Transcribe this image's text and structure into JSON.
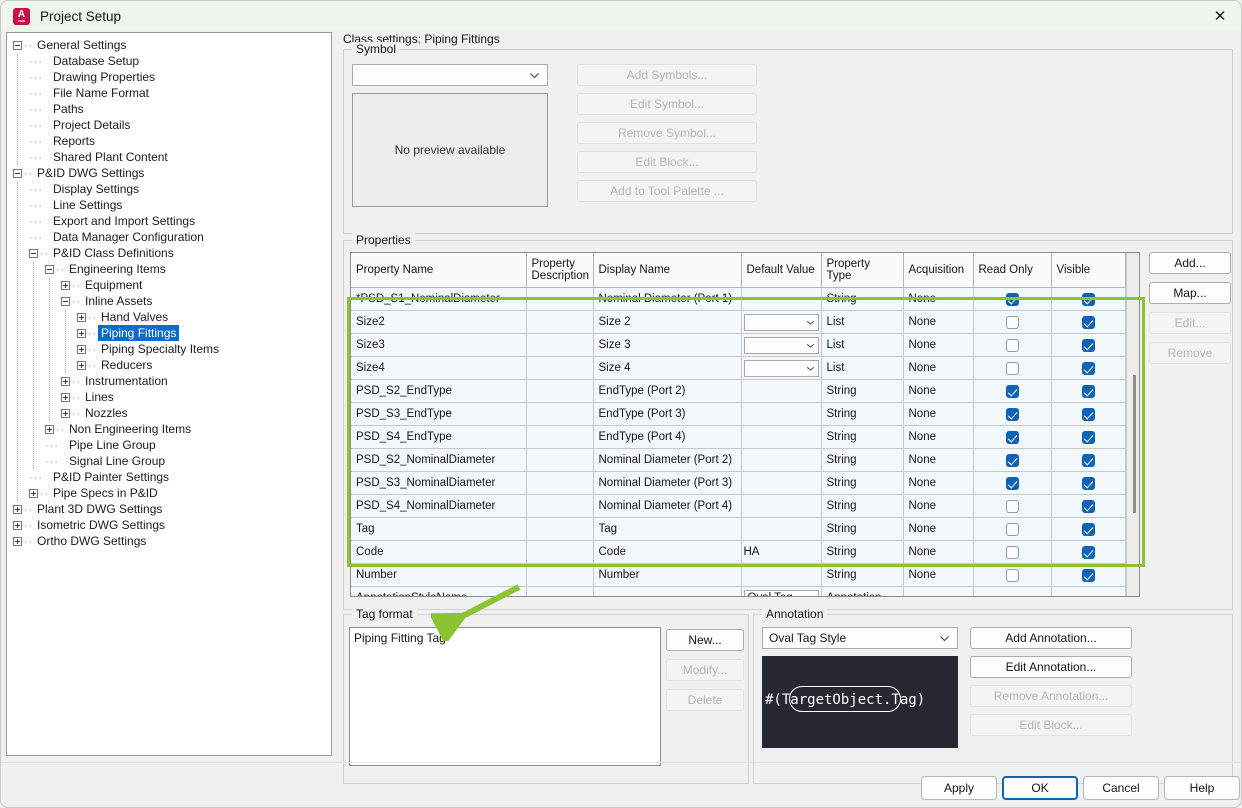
{
  "window": {
    "title": "Project Setup",
    "close_icon": "close-icon",
    "app_icon": "autocad-icon"
  },
  "tree": {
    "items": [
      {
        "label": "General Settings",
        "depth": 0,
        "toggle": "minus"
      },
      {
        "label": "Database Setup",
        "depth": 1,
        "toggle": "none"
      },
      {
        "label": "Drawing Properties",
        "depth": 1,
        "toggle": "none"
      },
      {
        "label": "File Name Format",
        "depth": 1,
        "toggle": "none"
      },
      {
        "label": "Paths",
        "depth": 1,
        "toggle": "none"
      },
      {
        "label": "Project Details",
        "depth": 1,
        "toggle": "none"
      },
      {
        "label": "Reports",
        "depth": 1,
        "toggle": "none"
      },
      {
        "label": "Shared Plant Content",
        "depth": 1,
        "toggle": "none"
      },
      {
        "label": "P&ID DWG Settings",
        "depth": 0,
        "toggle": "minus"
      },
      {
        "label": "Display Settings",
        "depth": 1,
        "toggle": "none"
      },
      {
        "label": "Line Settings",
        "depth": 1,
        "toggle": "none"
      },
      {
        "label": "Export and Import Settings",
        "depth": 1,
        "toggle": "none"
      },
      {
        "label": "Data Manager Configuration",
        "depth": 1,
        "toggle": "none"
      },
      {
        "label": "P&ID Class Definitions",
        "depth": 1,
        "toggle": "minus"
      },
      {
        "label": "Engineering Items",
        "depth": 2,
        "toggle": "minus"
      },
      {
        "label": "Equipment",
        "depth": 3,
        "toggle": "plus"
      },
      {
        "label": "Inline Assets",
        "depth": 3,
        "toggle": "minus"
      },
      {
        "label": "Hand Valves",
        "depth": 4,
        "toggle": "plus"
      },
      {
        "label": "Piping Fittings",
        "depth": 4,
        "toggle": "plus",
        "selected": true
      },
      {
        "label": "Piping Specialty Items",
        "depth": 4,
        "toggle": "plus"
      },
      {
        "label": "Reducers",
        "depth": 4,
        "toggle": "plus"
      },
      {
        "label": "Instrumentation",
        "depth": 3,
        "toggle": "plus"
      },
      {
        "label": "Lines",
        "depth": 3,
        "toggle": "plus"
      },
      {
        "label": "Nozzles",
        "depth": 3,
        "toggle": "plus"
      },
      {
        "label": "Non Engineering Items",
        "depth": 2,
        "toggle": "plus"
      },
      {
        "label": "Pipe Line Group",
        "depth": 2,
        "toggle": "none"
      },
      {
        "label": "Signal Line Group",
        "depth": 2,
        "toggle": "none"
      },
      {
        "label": "P&ID Painter Settings",
        "depth": 1,
        "toggle": "none"
      },
      {
        "label": "Pipe Specs in P&ID",
        "depth": 1,
        "toggle": "plus"
      },
      {
        "label": "Plant 3D DWG Settings",
        "depth": 0,
        "toggle": "plus"
      },
      {
        "label": "Isometric DWG Settings",
        "depth": 0,
        "toggle": "plus"
      },
      {
        "label": "Ortho DWG Settings",
        "depth": 0,
        "toggle": "plus"
      }
    ]
  },
  "content": {
    "class_settings_label": "Class settings: Piping Fittings",
    "symbol": {
      "legend": "Symbol",
      "combo_value": "",
      "preview_text": "No preview available",
      "buttons": [
        {
          "label": "Add Symbols...",
          "enabled": false
        },
        {
          "label": "Edit Symbol...",
          "enabled": false
        },
        {
          "label": "Remove Symbol...",
          "enabled": false
        },
        {
          "label": "Edit Block...",
          "enabled": false
        },
        {
          "label": "Add to Tool Palette ...",
          "enabled": false
        }
      ]
    },
    "properties": {
      "legend": "Properties",
      "columns": [
        "Property Name",
        "Property Description",
        "Display Name",
        "Default Value",
        "Property Type",
        "Acquisition",
        "Read Only",
        "Visible"
      ],
      "rows": [
        {
          "name": "*PSD_S1_NominalDiameter",
          "desc": "",
          "display": "Nominal Diameter (Port 1)",
          "default": "",
          "default_is_combo": false,
          "type": "String",
          "acq": "None",
          "readonly": true,
          "visible": true
        },
        {
          "name": "Size2",
          "desc": "",
          "display": "Size 2",
          "default": "",
          "default_is_combo": true,
          "type": "List",
          "acq": "None",
          "readonly": false,
          "visible": true
        },
        {
          "name": "Size3",
          "desc": "",
          "display": "Size 3",
          "default": "",
          "default_is_combo": true,
          "type": "List",
          "acq": "None",
          "readonly": false,
          "visible": true
        },
        {
          "name": "Size4",
          "desc": "",
          "display": "Size 4",
          "default": "",
          "default_is_combo": true,
          "type": "List",
          "acq": "None",
          "readonly": false,
          "visible": true
        },
        {
          "name": "PSD_S2_EndType",
          "desc": "",
          "display": "EndType (Port 2)",
          "default": "",
          "default_is_combo": false,
          "type": "String",
          "acq": "None",
          "readonly": true,
          "visible": true
        },
        {
          "name": "PSD_S3_EndType",
          "desc": "",
          "display": "EndType (Port 3)",
          "default": "",
          "default_is_combo": false,
          "type": "String",
          "acq": "None",
          "readonly": true,
          "visible": true
        },
        {
          "name": "PSD_S4_EndType",
          "desc": "",
          "display": "EndType (Port 4)",
          "default": "",
          "default_is_combo": false,
          "type": "String",
          "acq": "None",
          "readonly": true,
          "visible": true
        },
        {
          "name": "PSD_S2_NominalDiameter",
          "desc": "",
          "display": "Nominal Diameter (Port 2)",
          "default": "",
          "default_is_combo": false,
          "type": "String",
          "acq": "None",
          "readonly": true,
          "visible": true
        },
        {
          "name": "PSD_S3_NominalDiameter",
          "desc": "",
          "display": "Nominal Diameter (Port 3)",
          "default": "",
          "default_is_combo": false,
          "type": "String",
          "acq": "None",
          "readonly": true,
          "visible": true
        },
        {
          "name": "PSD_S4_NominalDiameter",
          "desc": "",
          "display": "Nominal Diameter (Port 4)",
          "default": "",
          "default_is_combo": false,
          "type": "String",
          "acq": "None",
          "readonly": false,
          "visible": true
        },
        {
          "name": "Tag",
          "desc": "",
          "display": "Tag",
          "default": "",
          "default_is_combo": false,
          "type": "String",
          "acq": "None",
          "readonly": false,
          "visible": true
        },
        {
          "name": "Code",
          "desc": "",
          "display": "Code",
          "default": "HA",
          "default_is_combo": false,
          "type": "String",
          "acq": "None",
          "readonly": false,
          "visible": true
        },
        {
          "name": "Number",
          "desc": "",
          "display": "Number",
          "default": "",
          "default_is_combo": false,
          "type": "String",
          "acq": "None",
          "readonly": false,
          "visible": true
        },
        {
          "name": "AnnotationStyleName",
          "desc": "",
          "display": "",
          "default": "Oval Tag...",
          "default_is_combo": true,
          "type": "Annotation",
          "acq": "",
          "readonly": null,
          "visible": null
        }
      ],
      "buttons": [
        {
          "label": "Add...",
          "enabled": true
        },
        {
          "label": "Map...",
          "enabled": true
        },
        {
          "label": "Edit...",
          "enabled": false
        },
        {
          "label": "Remove",
          "enabled": false
        }
      ]
    },
    "tag_format": {
      "legend": "Tag format",
      "list_items": [
        "Piping Fitting Tag"
      ],
      "buttons": [
        {
          "label": "New...",
          "enabled": true
        },
        {
          "label": "Modify...",
          "enabled": false
        },
        {
          "label": "Delete",
          "enabled": false
        }
      ]
    },
    "annotation": {
      "legend": "Annotation",
      "combo_value": "Oval Tag Style",
      "preview_text": "#(TargetObject.Tag)",
      "buttons": [
        {
          "label": "Add Annotation...",
          "enabled": true
        },
        {
          "label": "Edit Annotation...",
          "enabled": true
        },
        {
          "label": "Remove Annotation...",
          "enabled": false
        },
        {
          "label": "Edit Block...",
          "enabled": false
        }
      ]
    }
  },
  "footer": {
    "buttons": [
      {
        "label": "Apply",
        "primary": false
      },
      {
        "label": "OK",
        "primary": true
      },
      {
        "label": "Cancel",
        "primary": false
      },
      {
        "label": "Help",
        "primary": false
      }
    ]
  },
  "overlay": {
    "highlight_color": "#8cc431",
    "arrow_color": "#8cc431"
  }
}
